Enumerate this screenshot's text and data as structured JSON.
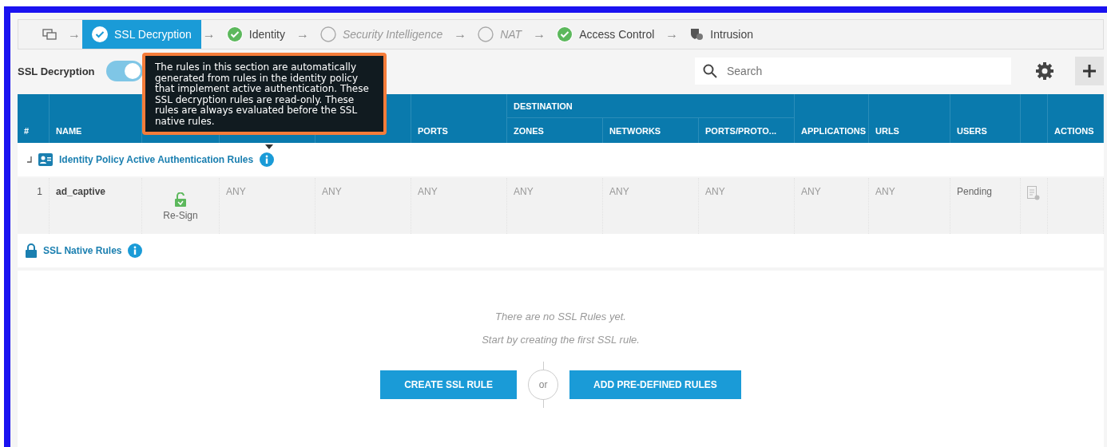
{
  "wizard": {
    "separator": "→",
    "steps": [
      {
        "kind": "device",
        "selected": false
      },
      {
        "kind": "done",
        "label": "SSL Decryption",
        "selected": true
      },
      {
        "kind": "done",
        "label": "Identity",
        "selected": false
      },
      {
        "kind": "pending",
        "label": "Security Intelligence",
        "selected": false
      },
      {
        "kind": "pending",
        "label": "NAT",
        "selected": false
      },
      {
        "kind": "done",
        "label": "Access Control",
        "selected": false
      },
      {
        "kind": "intrusion",
        "label": "Intrusion",
        "selected": false
      }
    ]
  },
  "toolbar": {
    "label": "SSL Decryption",
    "toggle_on": true,
    "search": {
      "placeholder": "Search"
    }
  },
  "tooltip": "The rules in this section are automatically generated from rules in the identity policy that implement active authentication. These SSL decryption rules are read-only. These rules are always evaluated before the SSL native rules.",
  "table": {
    "group": "DESTINATION",
    "columns": [
      {
        "label": "#"
      },
      {
        "label": "NAME"
      },
      {},
      {},
      {},
      {
        "label": "PORTS"
      },
      {
        "label": "ZONES"
      },
      {
        "label": "NETWORKS"
      },
      {
        "label": "PORTS/PROTO..."
      },
      {
        "label": "APPLICATIONS"
      },
      {
        "label": "URLS"
      },
      {
        "label": "USERS"
      },
      {},
      {
        "label": "ACTIONS"
      }
    ],
    "sections": [
      {
        "kind": "identity",
        "title": "Identity Policy Active Authentication Rules",
        "rows": [
          {
            "number": "1",
            "name": "ad_captive",
            "action": "Re-Sign",
            "cells": [
              "ANY",
              "ANY",
              "ANY",
              "ANY",
              "ANY",
              "ANY",
              "ANY",
              "ANY"
            ],
            "users": "Pending"
          }
        ]
      },
      {
        "kind": "native",
        "title": "SSL Native Rules"
      }
    ]
  },
  "empty_state": {
    "message": "There are no SSL Rules yet.",
    "hint": "Start by creating the first SSL rule.",
    "primary": "CREATE SSL RULE",
    "or": "or",
    "secondary": "ADD PRE-DEFINED RULES"
  }
}
